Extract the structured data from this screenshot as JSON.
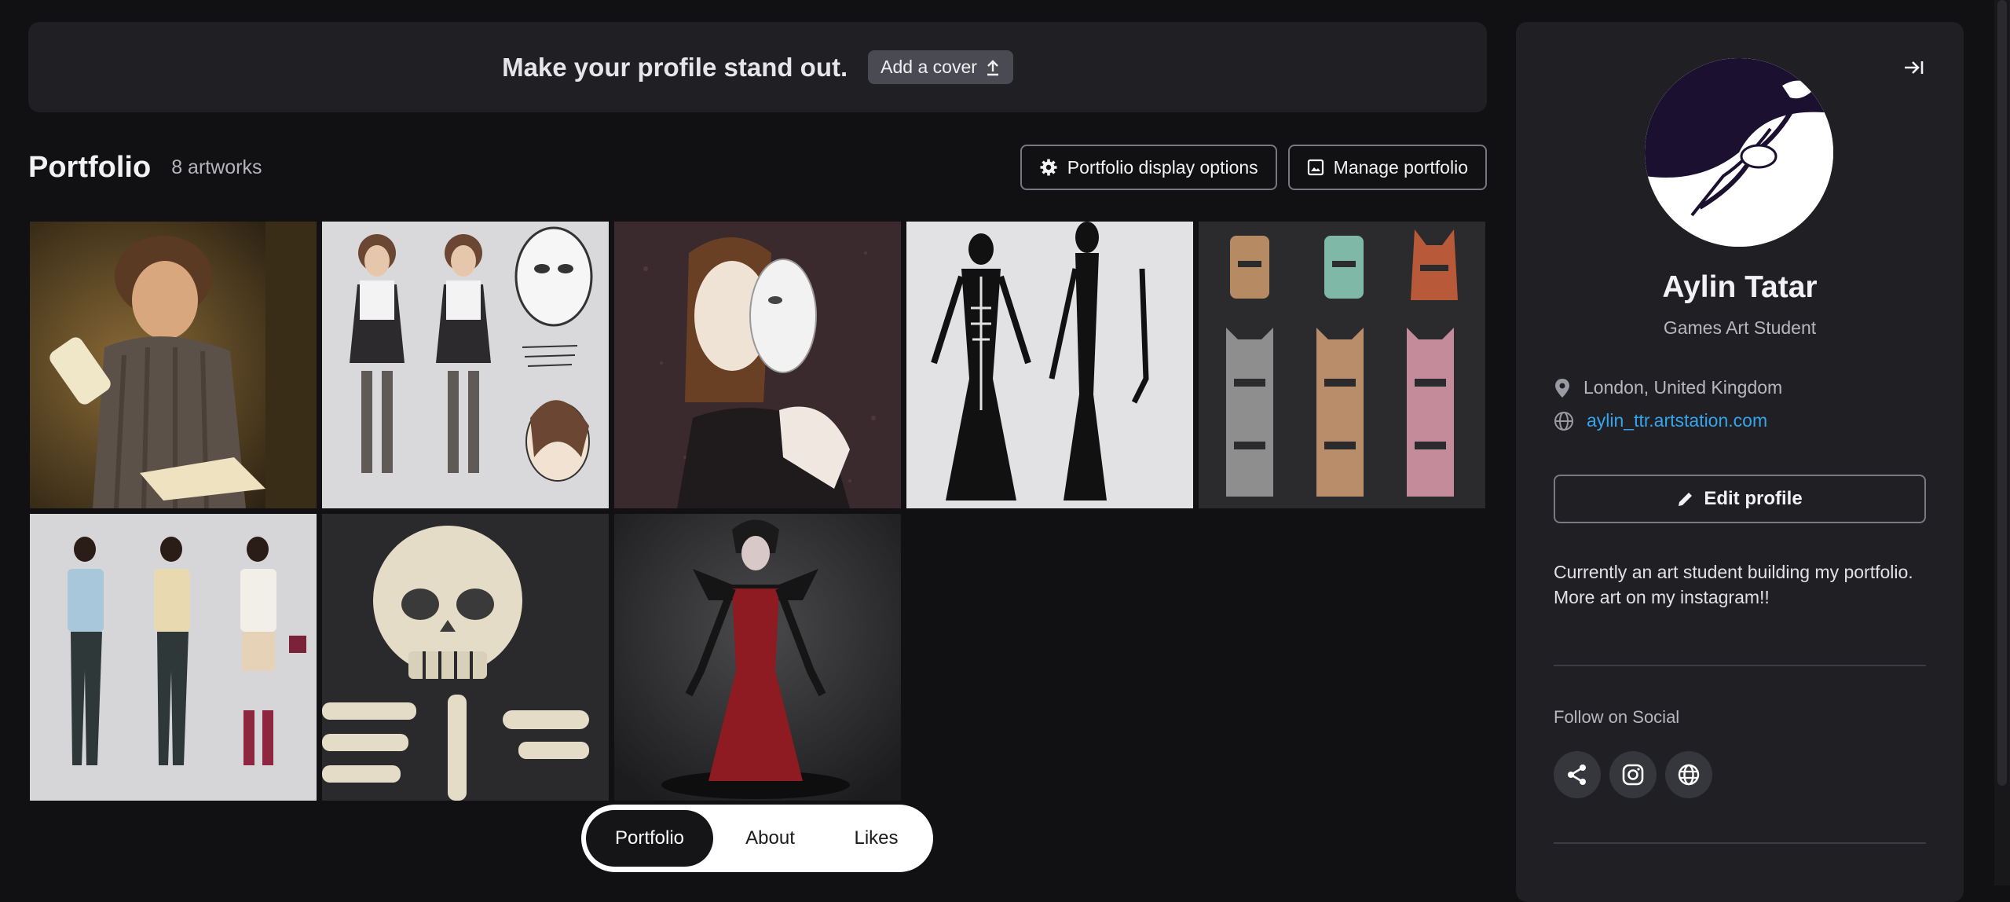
{
  "cover_banner": {
    "title": "Make your profile stand out.",
    "button_label": "Add a cover"
  },
  "portfolio": {
    "title": "Portfolio",
    "count": "8 artworks",
    "display_options_label": "Portfolio display options",
    "manage_label": "Manage portfolio"
  },
  "artworks": [
    {
      "name": "artwork-reading-girl"
    },
    {
      "name": "artwork-character-sheet"
    },
    {
      "name": "artwork-mask-girl"
    },
    {
      "name": "artwork-skeleton-dress"
    },
    {
      "name": "artwork-totems"
    },
    {
      "name": "artwork-three-outfits"
    },
    {
      "name": "artwork-skull"
    },
    {
      "name": "artwork-red-dress"
    }
  ],
  "tabs": [
    {
      "label": "Portfolio",
      "active": true
    },
    {
      "label": "About",
      "active": false
    },
    {
      "label": "Likes",
      "active": false
    }
  ],
  "profile": {
    "name": "Aylin Tatar",
    "role": "Games Art Student",
    "location": "London, United Kingdom",
    "website": "aylin_ttr.artstation.com",
    "edit_label": "Edit profile",
    "bio_line1": "Currently an art student building my portfolio.",
    "bio_line2": "More art on my instagram!!",
    "follow_label": "Follow on Social",
    "socials": [
      "share-icon",
      "instagram-icon",
      "globe-icon"
    ]
  },
  "colors": {
    "background": "#111114",
    "panel": "#1f1f24",
    "link": "#35a6ee"
  }
}
